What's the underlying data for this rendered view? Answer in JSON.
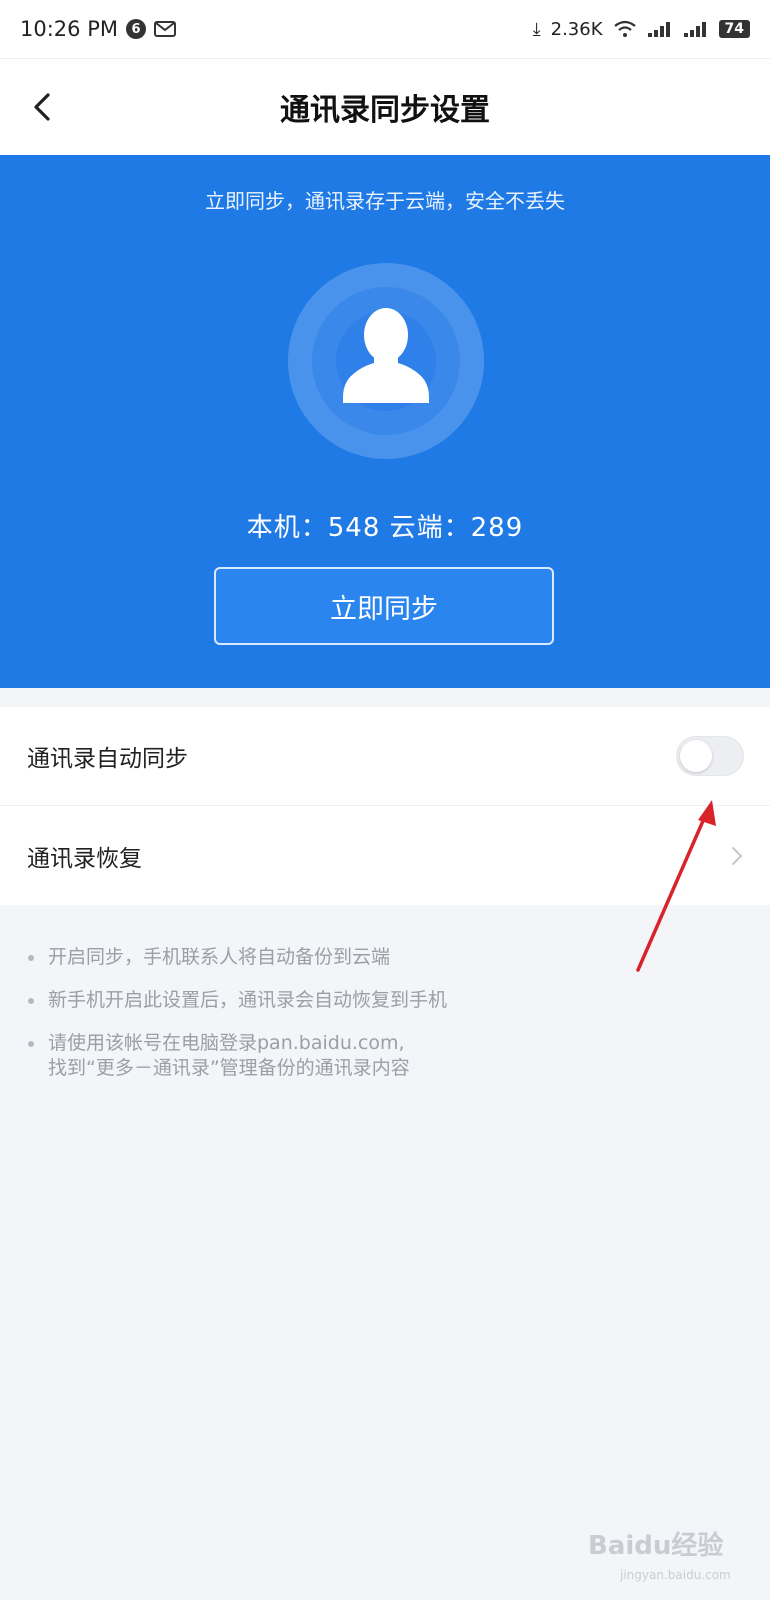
{
  "status_bar": {
    "time": "10:26 PM",
    "notification_count": "6",
    "net_speed": "2.36K",
    "battery": "74"
  },
  "header": {
    "title": "通讯录同步设置"
  },
  "banner": {
    "tip": "立即同步，通讯录存于云端，安全不丢失",
    "counts": "本机：548  云端：289",
    "sync_button": "立即同步"
  },
  "settings": {
    "auto_sync_label": "通讯录自动同步",
    "auto_sync_enabled": false,
    "restore_label": "通讯录恢复"
  },
  "notes": [
    "开启同步，手机联系人将自动备份到云端",
    "新手机开启此设置后，通讯录会自动恢复到手机",
    "请使用该帐号在电脑登录pan.baidu.com,",
    "找到“更多－通讯录”管理备份的通讯录内容"
  ],
  "watermark": {
    "brand": "Baidu经验",
    "url": "jingyan.baidu.com"
  },
  "colors": {
    "banner": "#1f7ae6",
    "annotation_arrow": "#d9232a"
  }
}
